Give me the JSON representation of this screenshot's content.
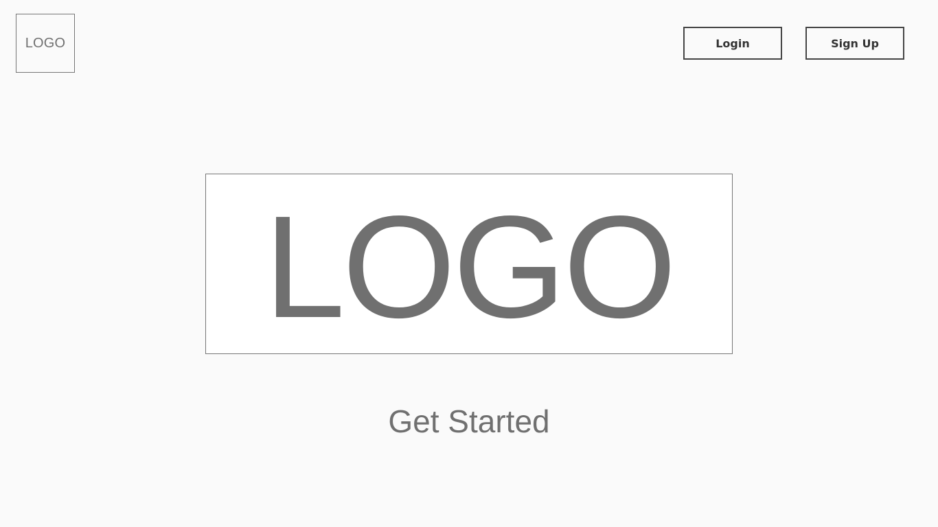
{
  "header": {
    "logo_text": "LOGO",
    "login_label": "Login",
    "signup_label": "Sign Up"
  },
  "hero": {
    "logo_text": "LOGO",
    "cta_label": "Get Started"
  },
  "colors": {
    "background": "#fafafa",
    "text_gray": "#707070",
    "button_border": "#444444",
    "logo_border": "#757575"
  }
}
